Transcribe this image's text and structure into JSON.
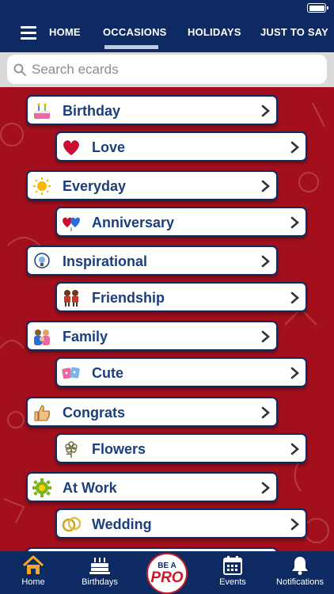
{
  "header": {
    "tabs": [
      {
        "label": "HOME"
      },
      {
        "label": "OCCASIONS"
      },
      {
        "label": "HOLIDAYS"
      },
      {
        "label": "JUST TO SAY"
      }
    ],
    "active_tab": "OCCASIONS"
  },
  "search": {
    "placeholder": "Search ecards",
    "value": ""
  },
  "categories": [
    {
      "label": "Birthday",
      "icon": "birthday-cake-icon"
    },
    {
      "label": "Love",
      "icon": "heart-icon"
    },
    {
      "label": "Everyday",
      "icon": "sun-icon"
    },
    {
      "label": "Anniversary",
      "icon": "hearts-icon"
    },
    {
      "label": "Inspirational",
      "icon": "lightbulb-icon"
    },
    {
      "label": "Friendship",
      "icon": "friends-icon"
    },
    {
      "label": "Family",
      "icon": "family-icon"
    },
    {
      "label": "Cute",
      "icon": "cute-icon"
    },
    {
      "label": "Congrats",
      "icon": "thumbs-up-icon"
    },
    {
      "label": "Flowers",
      "icon": "flower-icon"
    },
    {
      "label": "At Work",
      "icon": "gear-icon"
    },
    {
      "label": "Wedding",
      "icon": "rings-icon"
    }
  ],
  "bottom_nav": [
    {
      "label": "Home",
      "icon": "house-icon"
    },
    {
      "label": "Birthdays",
      "icon": "cake-icon"
    },
    {
      "label": "Events",
      "icon": "calendar-icon"
    },
    {
      "label": "Notifications",
      "icon": "bell-icon"
    }
  ],
  "pro_badge": {
    "line1": "BE A",
    "line2": "PRO"
  },
  "colors": {
    "header": "#0d2a63",
    "content": "#a3101c",
    "label": "#1b3f7c",
    "pro_red": "#c81b28"
  }
}
